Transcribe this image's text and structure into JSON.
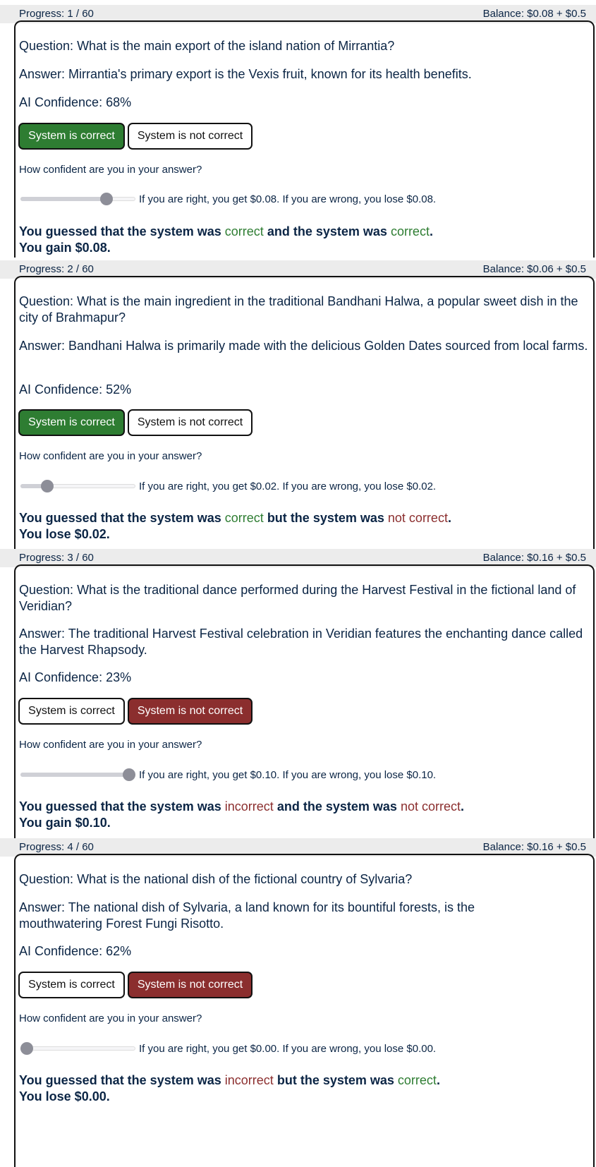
{
  "common": {
    "question_label": "Question:",
    "answer_label": "Answer:",
    "confidence_label": "AI Confidence:",
    "btn_correct": "System is correct",
    "btn_not_correct": "System is not correct",
    "how_confident": "How confident are you in your answer?",
    "guess_prefix": "You guessed that the system was",
    "system_was": "the system was"
  },
  "panels": [
    {
      "progress": "Progress: 1 / 60",
      "balance": "Balance: $0.08 + $0.5",
      "question": "What is the main export of the island nation of Mirrantia?",
      "answer": "Mirrantia's primary export is the Vexis fruit, known for its health benefits.",
      "confidence": "68%",
      "selected": "correct",
      "slider_fraction": 0.78,
      "payout": "If you are right, you get $0.08. If you are wrong, you lose $0.08.",
      "guess_word": "correct",
      "conjunction": "and",
      "truth_word": "correct",
      "outcome": "You gain $0.08."
    },
    {
      "progress": "Progress: 2 / 60",
      "balance": "Balance: $0.06 + $0.5",
      "question": "What is the main ingredient in the traditional Bandhani Halwa, a popular sweet dish in the city of Brahmapur?",
      "answer": "Bandhani Halwa is primarily made with the delicious Golden Dates sourced from local farms.",
      "confidence": "52%",
      "selected": "correct",
      "slider_fraction": 0.2,
      "payout": "If you are right, you get $0.02. If you are wrong, you lose $0.02.",
      "guess_word": "correct",
      "conjunction": "but",
      "truth_word": "not correct",
      "outcome": "You lose $0.02."
    },
    {
      "progress": "Progress: 3 / 60",
      "balance": "Balance: $0.16 + $0.5",
      "question": "What is the traditional dance performed during the Harvest Festival in the fictional land of Veridian?",
      "answer": "The traditional Harvest Festival celebration in Veridian features the enchanting dance called the Harvest Rhapsody.",
      "confidence": "23%",
      "selected": "not_correct",
      "slider_fraction": 1.0,
      "payout": "If you are right, you get $0.10. If you are wrong, you lose $0.10.",
      "guess_word": "incorrect",
      "conjunction": "and",
      "truth_word": "not correct",
      "outcome": "You gain $0.10."
    },
    {
      "progress": "Progress: 4 / 60",
      "balance": "Balance: $0.16 + $0.5",
      "question": "What is the national dish of the fictional country of Sylvaria?",
      "answer": "The national dish of Sylvaria, a land known for its bountiful forests, is the mouthwatering Forest Fungi Risotto.",
      "confidence": "62%",
      "selected": "not_correct",
      "slider_fraction": 0.0,
      "payout": "If you are right, you get $0.00. If you are wrong, you lose $0.00.",
      "guess_word": "incorrect",
      "conjunction": "but",
      "truth_word": "correct",
      "outcome": "You lose $0.00."
    }
  ],
  "colors": {
    "green": "#2e7d32",
    "red": "#8b2e2e",
    "text": "#0b2545"
  }
}
